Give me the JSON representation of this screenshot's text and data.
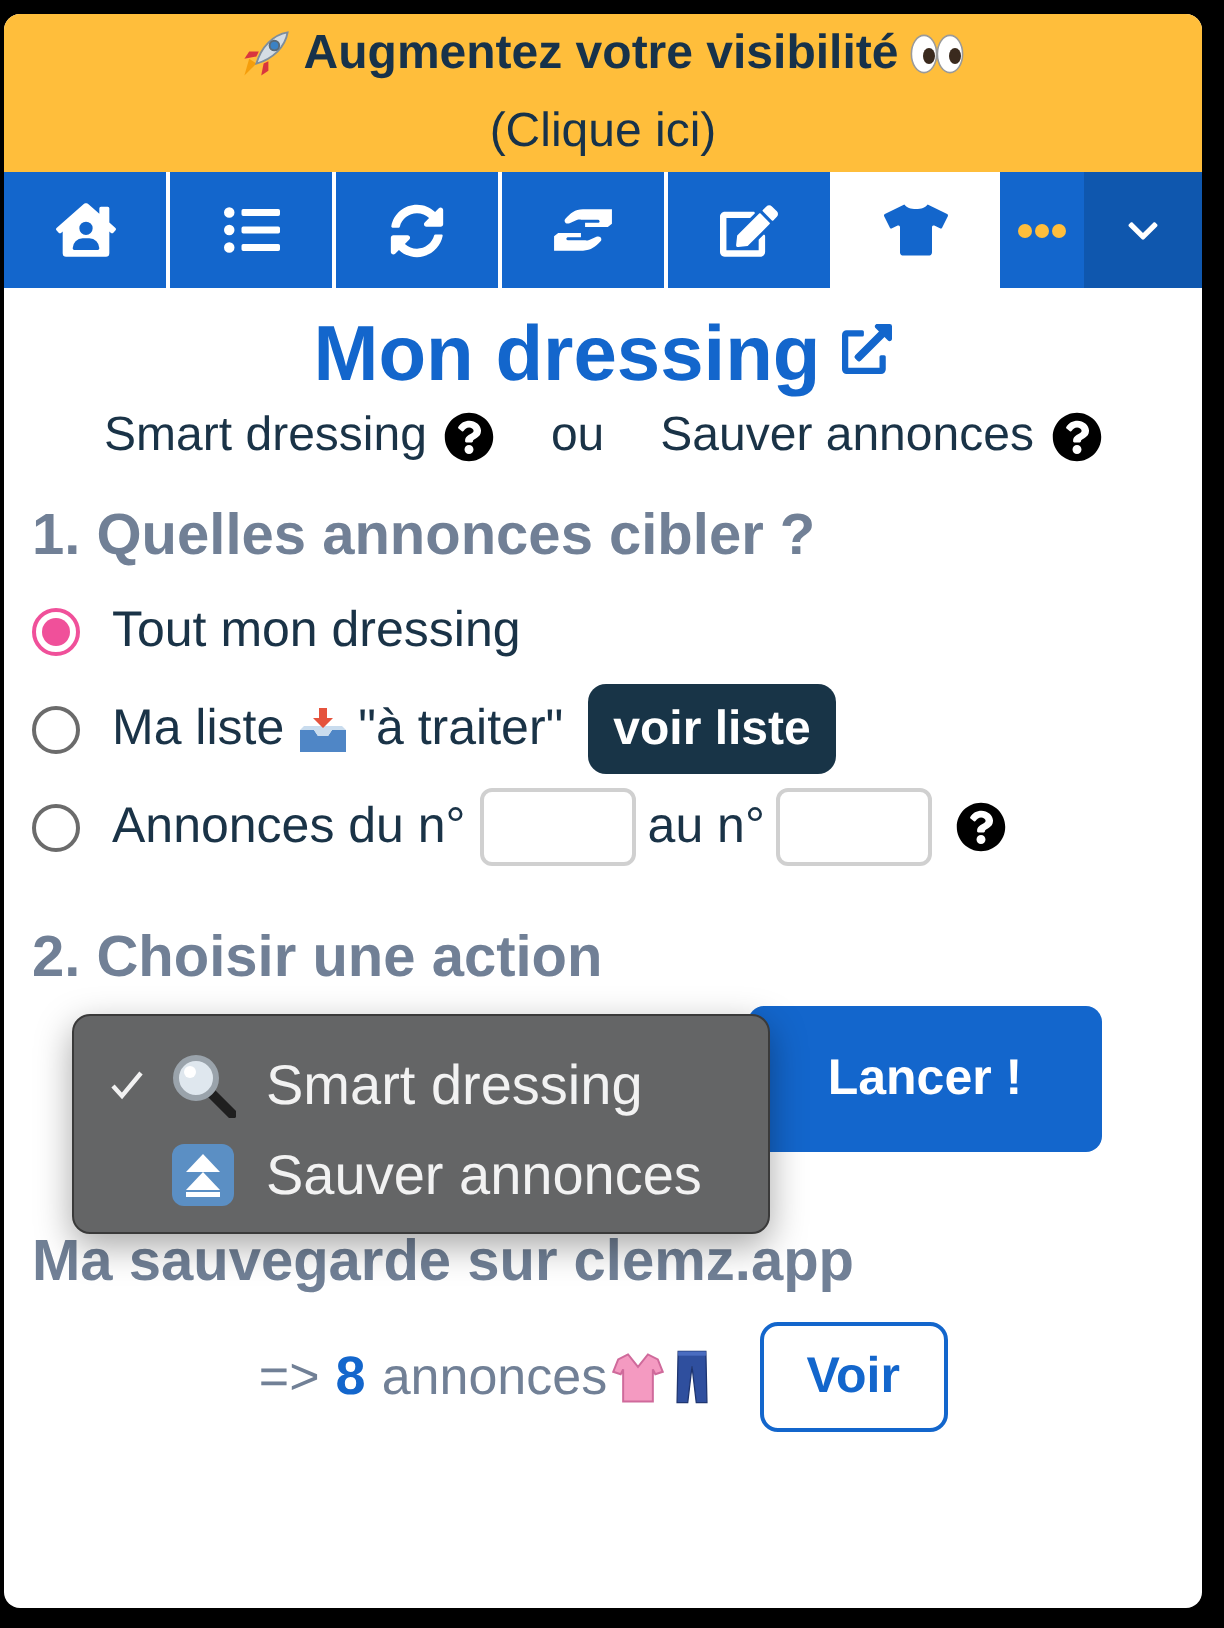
{
  "banner": {
    "title": "Augmentez votre visibilité",
    "link": "(Clique ici)"
  },
  "nav": {
    "tabs": [
      {
        "selected": false
      },
      {
        "selected": false
      },
      {
        "selected": false
      },
      {
        "selected": false
      },
      {
        "selected": false
      },
      {
        "selected": true
      }
    ]
  },
  "page": {
    "title": "Mon dressing",
    "help_topics": [
      {
        "label": "Smart dressing"
      },
      {
        "label": "Sauver annonces"
      }
    ],
    "connector": "ou"
  },
  "section_1": {
    "heading": "1. Quelles annonces cibler ?",
    "options": [
      {
        "kind": "all",
        "label": "Tout mon dressing",
        "selected": true
      },
      {
        "kind": "list",
        "label": "Ma liste",
        "tag": "\"à traiter\"",
        "button": "voir liste",
        "selected": false
      },
      {
        "kind": "range",
        "label": "Annonces du n°",
        "between": "au n°",
        "selected": false
      }
    ]
  },
  "section_2": {
    "heading": "2. Choisir une action",
    "menu": {
      "options": [
        {
          "label": "Smart dressing",
          "selected": true
        },
        {
          "label": "Sauver annonces",
          "selected": false
        }
      ]
    },
    "launch_button": "Lancer !"
  },
  "backup": {
    "heading": "Ma sauvegarde sur clemz.app",
    "prefix": "=>",
    "count": "8",
    "suffix": "annonces",
    "button": "Voir"
  }
}
